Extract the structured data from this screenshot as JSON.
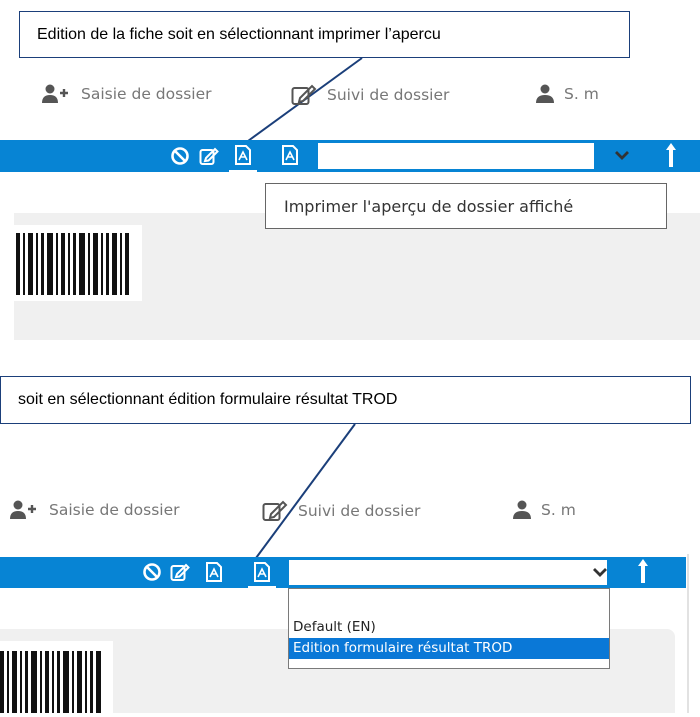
{
  "colors": {
    "toolbar": "#0784d4",
    "selected": "#0a78d7",
    "callout_border": "#1b3f7a",
    "panel": "#f0f0f0"
  },
  "callouts": [
    {
      "text": "Edition de la fiche soit en sélectionnant imprimer l’apercu"
    },
    {
      "text": "soit en sélectionnant édition formulaire résultat TROD"
    }
  ],
  "nav": {
    "saisie": {
      "label": "Saisie de dossier",
      "icon": "user-plus-icon"
    },
    "suivi": {
      "label": "Suivi de dossier",
      "icon": "edit-icon"
    },
    "user": {
      "label": "S. m",
      "icon": "user-icon"
    }
  },
  "toolbar_icons": [
    "cancel-icon",
    "edit-icon",
    "pdf-preview-icon",
    "pdf-form-icon"
  ],
  "tooltip": {
    "text": "Imprimer l'aperçu de dossier affiché"
  },
  "dropdown": {
    "options": [
      "Default (EN)",
      "Edition formulaire résultat TROD"
    ],
    "selected_index": 1
  }
}
